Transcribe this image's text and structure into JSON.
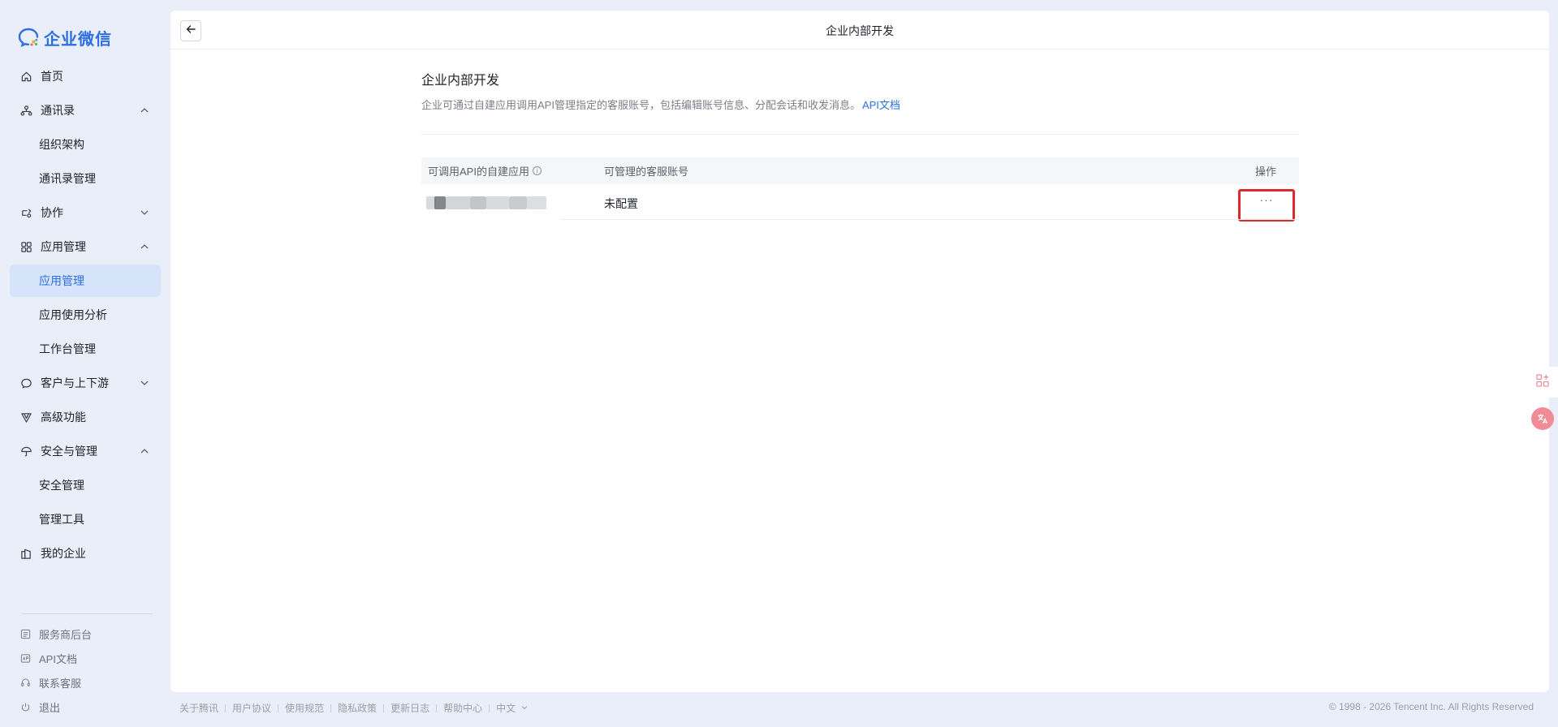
{
  "brand": {
    "name": "企业微信",
    "accent": "#2b6fe0"
  },
  "sidebar": {
    "items": [
      {
        "label": "首页",
        "icon": "home-icon",
        "level": 0
      },
      {
        "label": "通讯录",
        "icon": "org-icon",
        "level": 0,
        "chevron": "up"
      },
      {
        "label": "组织架构",
        "level": 1
      },
      {
        "label": "通讯录管理",
        "level": 1
      },
      {
        "label": "协作",
        "icon": "collab-icon",
        "level": 0,
        "chevron": "down"
      },
      {
        "label": "应用管理",
        "icon": "apps-icon",
        "level": 0,
        "chevron": "up"
      },
      {
        "label": "应用管理",
        "level": 1,
        "active": true
      },
      {
        "label": "应用使用分析",
        "level": 1
      },
      {
        "label": "工作台管理",
        "level": 1
      },
      {
        "label": "客户与上下游",
        "icon": "chat-icon",
        "level": 0,
        "chevron": "down"
      },
      {
        "label": "高级功能",
        "icon": "advanced-icon",
        "level": 0
      },
      {
        "label": "安全与管理",
        "icon": "umbrella-icon",
        "level": 0,
        "chevron": "up"
      },
      {
        "label": "安全管理",
        "level": 1
      },
      {
        "label": "管理工具",
        "level": 1
      },
      {
        "label": "我的企业",
        "icon": "company-icon",
        "level": 0
      }
    ],
    "footer": [
      {
        "label": "服务商后台",
        "icon": "service-icon"
      },
      {
        "label": "API文档",
        "icon": "api-icon"
      },
      {
        "label": "联系客服",
        "icon": "headset-icon"
      },
      {
        "label": "退出",
        "icon": "power-icon"
      }
    ]
  },
  "topbar": {
    "title": "企业内部开发"
  },
  "content": {
    "title": "企业内部开发",
    "description": "企业可通过自建应用调用API管理指定的客服账号，包括编辑账号信息、分配会话和收发消息。",
    "doc_link": "API文档",
    "table": {
      "headers": {
        "app": "可调用API的自建应用",
        "accounts": "可管理的客服账号",
        "ops": "操作"
      },
      "rows": [
        {
          "accounts": "未配置",
          "ops": "···"
        }
      ]
    }
  },
  "footer": {
    "links": [
      "关于腾讯",
      "用户协议",
      "使用规范",
      "隐私政策",
      "更新日志",
      "帮助中心"
    ],
    "language": "中文",
    "copyright": "© 1998 - 2026 Tencent Inc. All Rights Reserved"
  }
}
